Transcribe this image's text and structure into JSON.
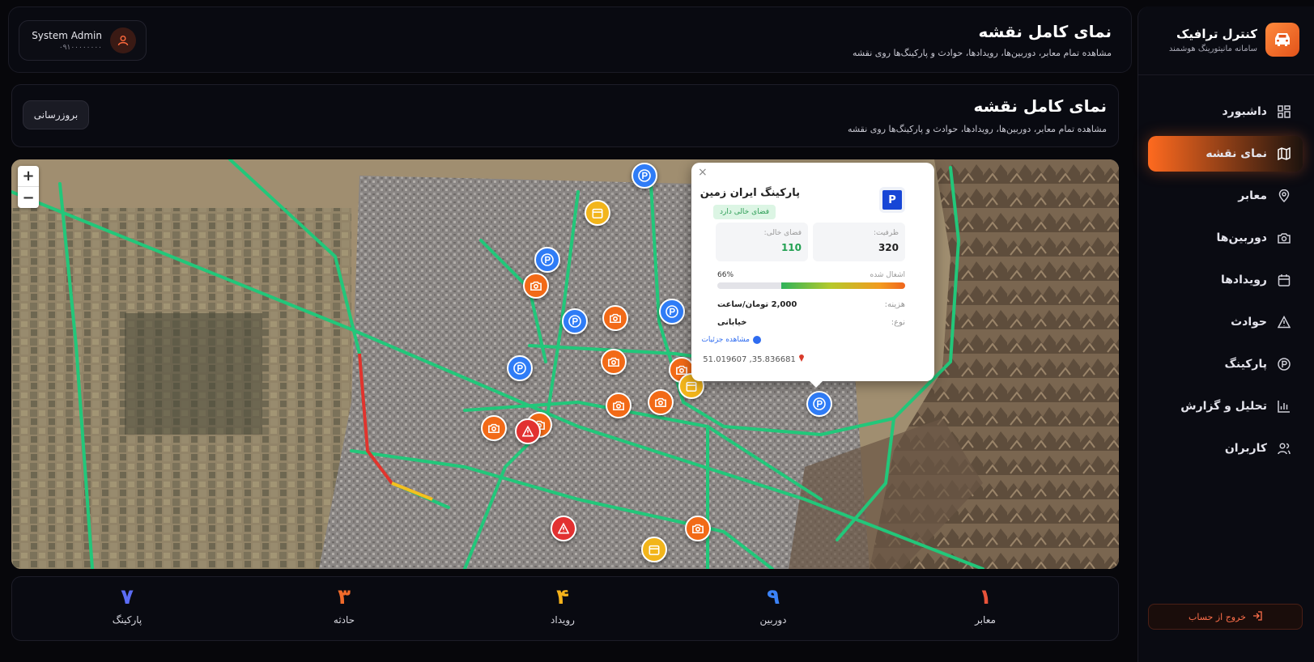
{
  "brand": {
    "title": "کنترل ترافیک",
    "subtitle": "سامانه مانیتورینگ هوشمند",
    "logo_icon": "car-icon",
    "accent": "#ff6a1f"
  },
  "sidebar": {
    "items": [
      {
        "label": "داشبورد",
        "icon": "dashboard-grid-icon"
      },
      {
        "label": "نمای نقشه",
        "icon": "map-icon",
        "active": true
      },
      {
        "label": "معابر",
        "icon": "location-pin-icon"
      },
      {
        "label": "دوربین‌ها",
        "icon": "camera-icon"
      },
      {
        "label": "رویدادها",
        "icon": "calendar-icon"
      },
      {
        "label": "حوادث",
        "icon": "warning-icon"
      },
      {
        "label": "پارکینگ",
        "icon": "parking-icon"
      },
      {
        "label": "تحلیل و گزارش",
        "icon": "bar-chart-icon"
      },
      {
        "label": "کاربران",
        "icon": "users-icon"
      }
    ],
    "logout_label": "خروج از حساب"
  },
  "header": {
    "title": "نمای کامل نقشه",
    "subtitle": "مشاهده تمام معابر، دوربین‌ها، رویدادها، حوادث و پارکینگ‌ها روی نقشه",
    "user": {
      "name": "System Admin",
      "phone": "۰۹۱۰۰۰۰۰۰۰۰"
    }
  },
  "panel": {
    "title": "نمای کامل نقشه",
    "subtitle": "مشاهده تمام معابر، دوربین‌ها، رویدادها، حوادث و پارکینگ‌ها روی نقشه",
    "refresh_label": "بروزرسانی"
  },
  "map": {
    "zoom_in": "+",
    "zoom_out": "−",
    "popup": {
      "close": "×",
      "icon_letter": "P",
      "title": "پارکینگ ایران زمین",
      "badge": "فضای خالی دارد",
      "capacity_label": "ظرفیت:",
      "capacity_value": "320",
      "free_label": "فضای خالی:",
      "free_value": "110",
      "occupied_label": "اشغال شده",
      "occupied_value": "66%",
      "occupied_fraction": 0.66,
      "cost_label": "هزینه:",
      "cost_value": "2,000 تومان/ساعت",
      "type_label": "نوع:",
      "type_value": "خیابانی",
      "link_label": "مشاهده جزئیات",
      "coords": "51.019607 ,35.836681"
    },
    "marker_colors": {
      "parking": "#2f7cf6",
      "camera": "#f26a17",
      "event": "#f2b51b",
      "incident": "#e23131"
    }
  },
  "stats": [
    {
      "value": "۱",
      "label": "معابر",
      "color": "#e8533a"
    },
    {
      "value": "۹",
      "label": "دوربین",
      "color": "#3b82f6"
    },
    {
      "value": "۴",
      "label": "رویداد",
      "color": "#f5b21b"
    },
    {
      "value": "۳",
      "label": "حادثه",
      "color": "#f06a2a"
    },
    {
      "value": "۷",
      "label": "پارکینگ",
      "color": "#5b6cf5"
    }
  ]
}
